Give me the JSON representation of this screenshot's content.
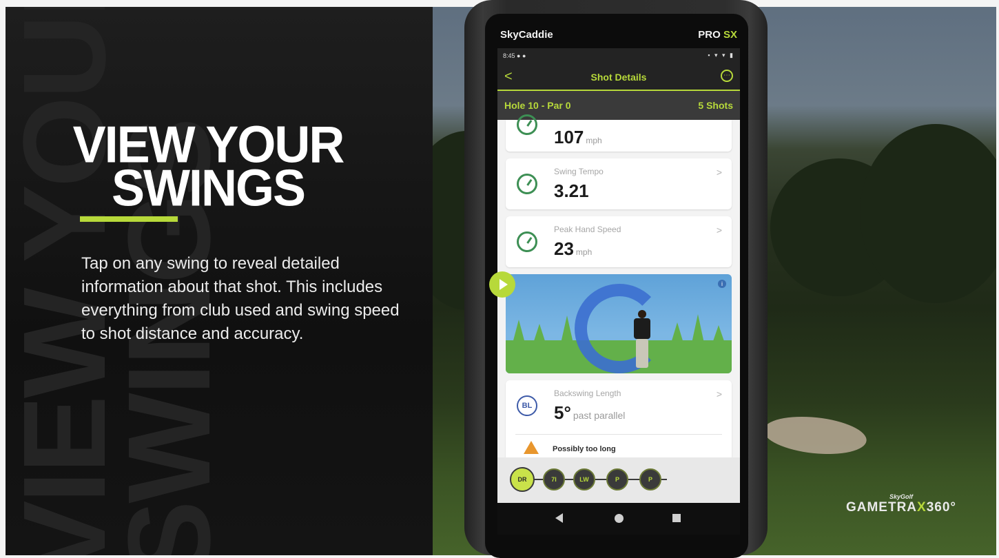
{
  "left": {
    "bg_text": [
      "VIEW YOUR",
      "SWINGS"
    ],
    "headline_line1": "VIEW YOUR",
    "headline_line2": "SWINGS",
    "description": "Tap on any swing to reveal detailed information about that shot. This includes everything from club used and swing speed to shot distance and accuracy."
  },
  "device": {
    "brand_logo": "SkyCaddie",
    "model_prefix": "PRO",
    "model_suffix": "SX"
  },
  "status_bar": {
    "time": "8:45 ● ●",
    "icons": "▪ ▾ ▾ ▮"
  },
  "app_bar": {
    "back": "<",
    "title": "Shot Details",
    "menu": "⋯"
  },
  "hole_bar": {
    "hole": "Hole 10 - Par 0",
    "shots": "5 Shots"
  },
  "metrics": [
    {
      "label": "",
      "value": "107",
      "unit": "mph"
    },
    {
      "label": "Swing Tempo",
      "value": "3.21",
      "unit": ""
    },
    {
      "label": "Peak Hand Speed",
      "value": "23",
      "unit": "mph"
    }
  ],
  "backswing": {
    "badge": "BL",
    "label": "Backswing Length",
    "value": "5°",
    "unit": "past parallel",
    "warning": "Possibly too long"
  },
  "swing_panel": {
    "info": "i"
  },
  "clubs": [
    "DR",
    "7I",
    "LW",
    "P",
    "P"
  ],
  "chevron": ">",
  "branding": {
    "top": "SkyGolf",
    "main_a": "GAMETRA",
    "main_x": "X",
    "main_b": "360°"
  },
  "colors": {
    "accent": "#b7d93a",
    "gauge": "#3d8f54",
    "warning": "#e8962d"
  }
}
